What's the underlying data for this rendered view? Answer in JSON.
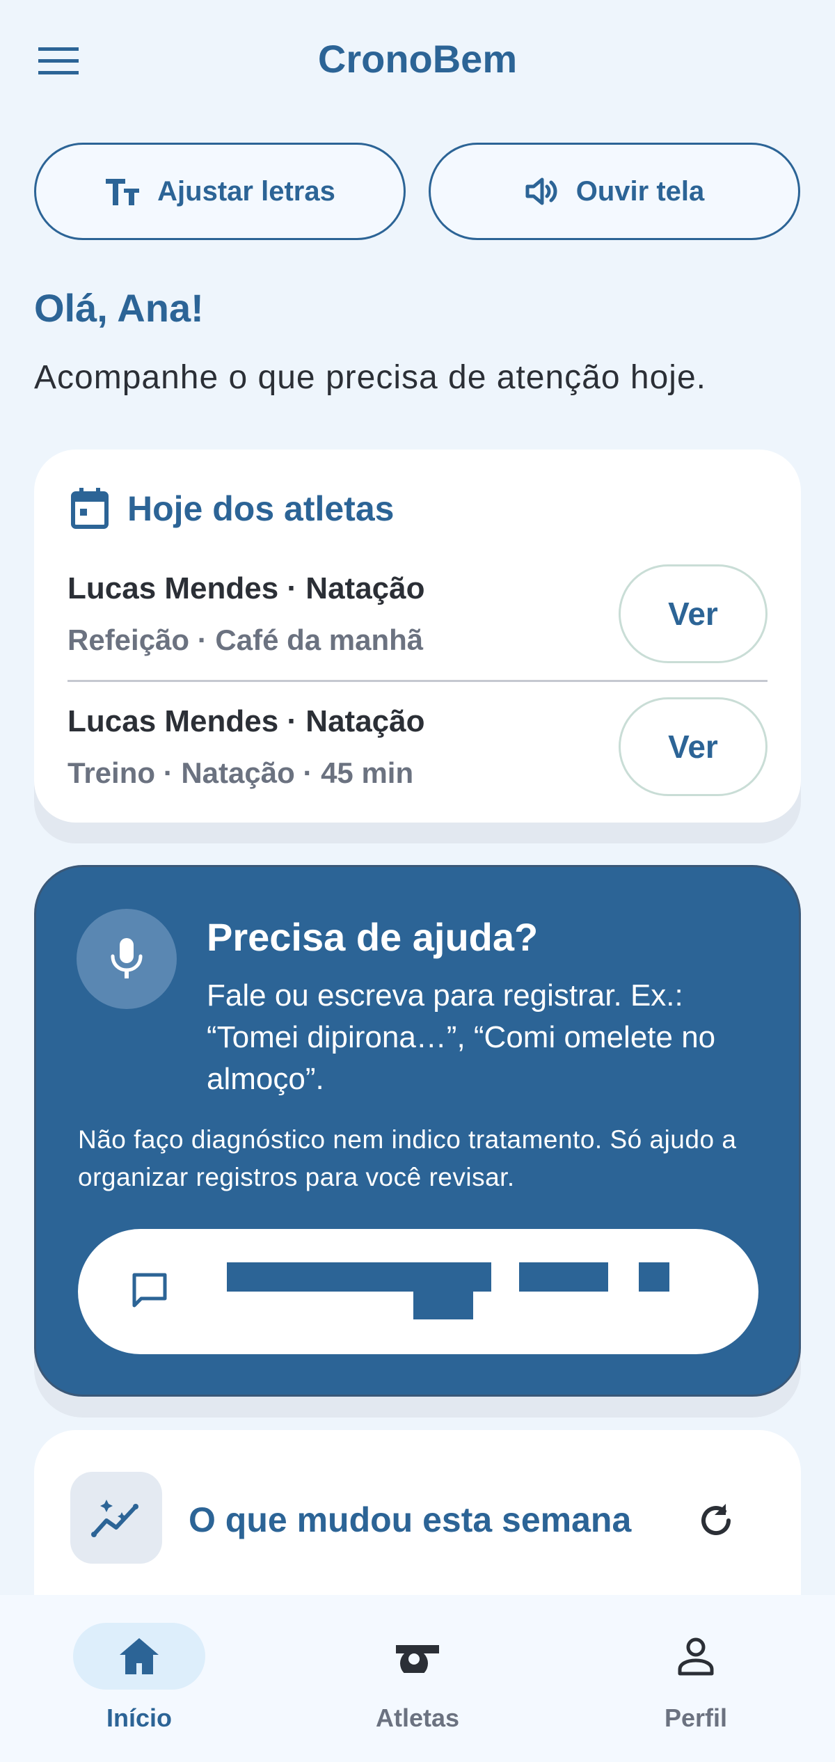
{
  "app": {
    "title": "CronoBem"
  },
  "toolbar": {
    "adjust_text_label": "Ajustar letras",
    "listen_label": "Ouvir tela"
  },
  "greeting": {
    "title": "Olá, Ana!",
    "subtitle": "Acompanhe o que precisa de atenção hoje."
  },
  "today": {
    "title": "Hoje dos atletas",
    "items": [
      {
        "title": "Lucas Mendes · Natação",
        "subtitle": "Refeição · Café da manhã",
        "action": "Ver"
      },
      {
        "title": "Lucas Mendes · Natação",
        "subtitle": "Treino · Natação · 45 min",
        "action": "Ver"
      }
    ]
  },
  "help": {
    "title": "Precisa de ajuda?",
    "text": "Fale ou escreva para registrar. Ex.: “Tomei dipirona…”, “Comi omelete no almoço”.",
    "note": "Não faço diagnóstico nem indico tratamento. Só ajudo a organizar registros para você revisar."
  },
  "weekly": {
    "title": "O que mudou esta semana"
  },
  "nav": {
    "items": [
      {
        "label": "Início",
        "icon": "home-icon",
        "active": true
      },
      {
        "label": "Atletas",
        "icon": "whistle-icon",
        "active": false
      },
      {
        "label": "Perfil",
        "icon": "person-icon",
        "active": false
      }
    ]
  },
  "colors": {
    "primary": "#2C6496",
    "background": "#EEF5FC",
    "muted": "#6B7280"
  }
}
